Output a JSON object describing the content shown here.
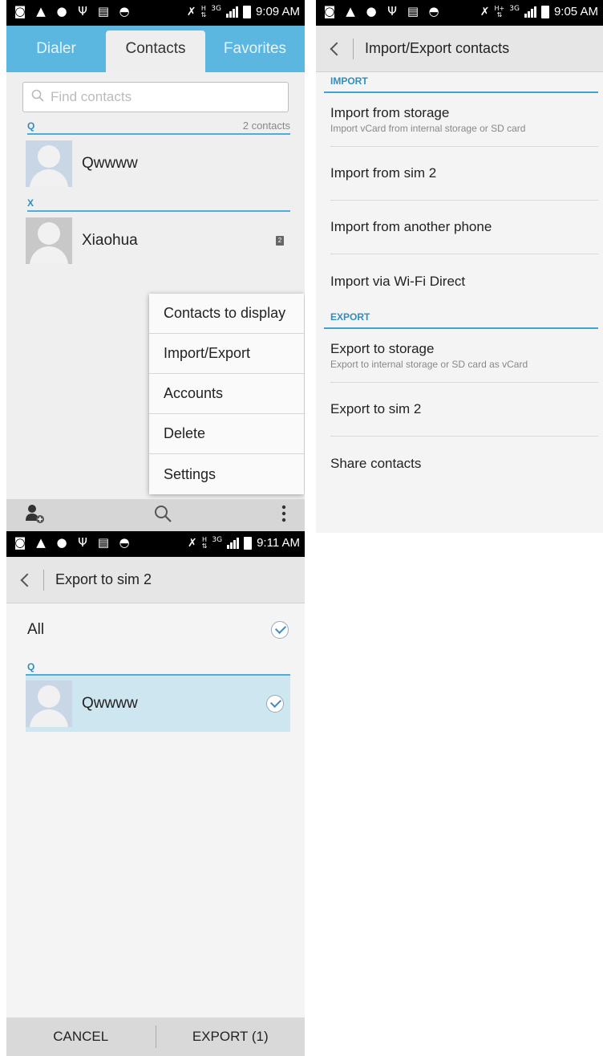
{
  "status_bars": {
    "screen1_time": "9:09 AM",
    "screen2_time": "9:05 AM",
    "screen3_time": "9:11 AM",
    "network": "3G"
  },
  "contacts_screen": {
    "tabs": [
      "Dialer",
      "Contacts",
      "Favorites"
    ],
    "active_tab": "Contacts",
    "search_placeholder": "Find contacts",
    "sections": [
      {
        "letter": "Q",
        "count": "2 contacts",
        "contacts": [
          {
            "name": "Qwwww"
          }
        ]
      },
      {
        "letter": "X",
        "count": "",
        "contacts": [
          {
            "name": "Xiaohua",
            "sim_badge": "2"
          }
        ]
      }
    ],
    "menu": [
      "Contacts to display",
      "Import/Export",
      "Accounts",
      "Delete",
      "Settings"
    ],
    "bottom_icons": [
      "add-contact-icon",
      "search-icon",
      "overflow-menu-icon"
    ]
  },
  "import_export_screen": {
    "title": "Import/Export contacts",
    "import_header": "IMPORT",
    "import_items": [
      {
        "title": "Import from storage",
        "subtitle": "Import vCard from internal storage or SD card"
      },
      {
        "title": "Import from sim 2",
        "subtitle": ""
      },
      {
        "title": "Import from another phone",
        "subtitle": ""
      },
      {
        "title": "Import via Wi-Fi Direct",
        "subtitle": ""
      }
    ],
    "export_header": "EXPORT",
    "export_items": [
      {
        "title": "Export to storage",
        "subtitle": "Export to internal storage or SD card as vCard"
      },
      {
        "title": "Export to sim 2",
        "subtitle": ""
      },
      {
        "title": "Share contacts",
        "subtitle": ""
      }
    ]
  },
  "export_sim_screen": {
    "title": "Export to sim 2",
    "all_label": "All",
    "section_letter": "Q",
    "contact_name": "Qwwww",
    "cancel_label": "CANCEL",
    "export_label": "EXPORT (1)"
  },
  "colors": {
    "accent_blue": "#5bb6e0",
    "section_divider": "#3ea4d4",
    "selected_row": "#cde6ef"
  }
}
